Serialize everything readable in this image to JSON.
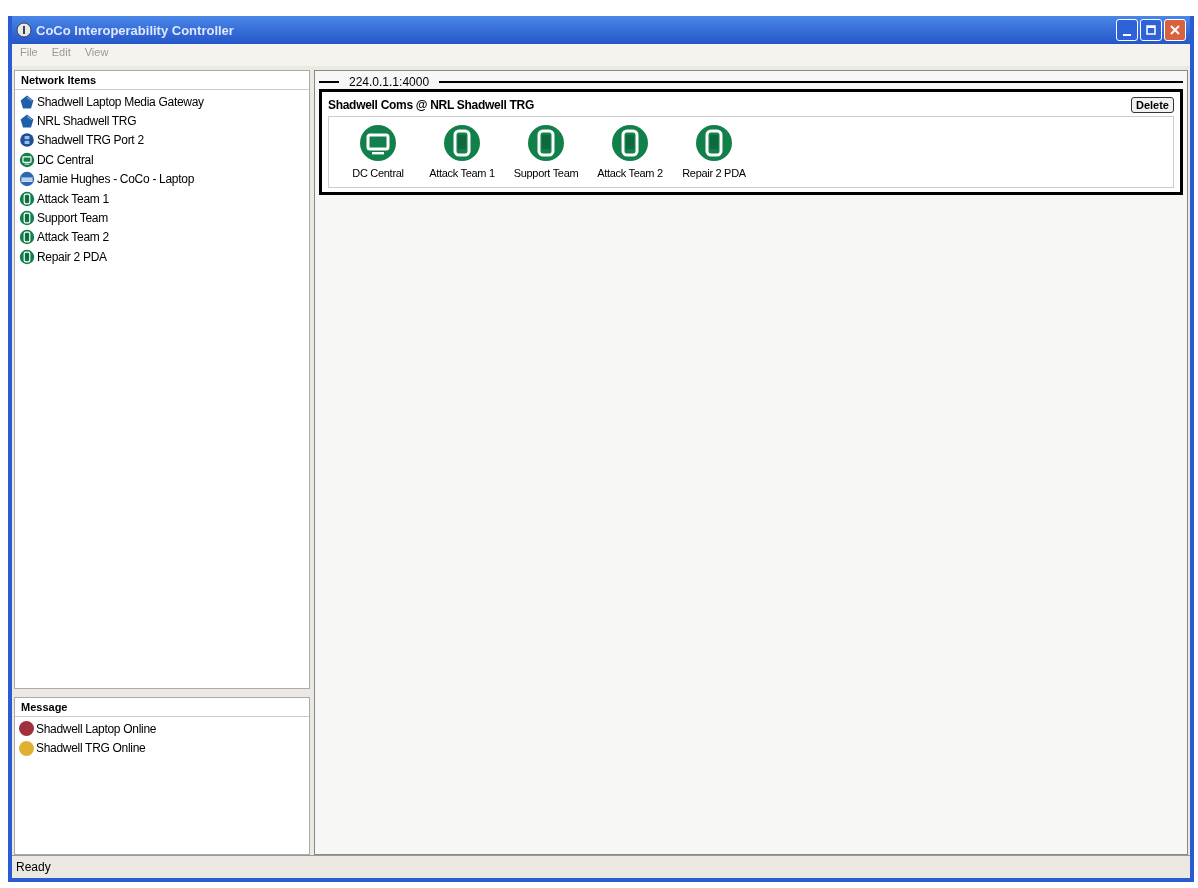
{
  "window": {
    "title": "CoCo Interoperability Controller"
  },
  "menu": [
    "File",
    "Edit",
    "View"
  ],
  "network_panel": {
    "title": "Network Items",
    "items": [
      {
        "label": "Shadwell Laptop Media Gateway",
        "kind": "gateway"
      },
      {
        "label": "NRL Shadwell TRG",
        "kind": "gateway"
      },
      {
        "label": "Shadwell TRG Port 2",
        "kind": "port"
      },
      {
        "label": "DC Central",
        "kind": "workstation"
      },
      {
        "label": "Jamie Hughes - CoCo - Laptop",
        "kind": "laptop"
      },
      {
        "label": "Attack Team 1",
        "kind": "handheld"
      },
      {
        "label": "Support Team",
        "kind": "handheld"
      },
      {
        "label": "Attack Team 2",
        "kind": "handheld"
      },
      {
        "label": "Repair 2 PDA",
        "kind": "handheld"
      }
    ]
  },
  "message_panel": {
    "title": "Message",
    "items": [
      {
        "text": "Shadwell Laptop Online",
        "color": "#a0303c"
      },
      {
        "text": "Shadwell TRG Online",
        "color": "#e0b030"
      }
    ]
  },
  "channel": {
    "address": "224.0.1.1:4000",
    "group": {
      "title": "Shadwell Coms @ NRL Shadwell TRG",
      "delete_button": "Delete",
      "nodes": [
        {
          "label": "DC Central",
          "kind": "workstation"
        },
        {
          "label": "Attack Team 1",
          "kind": "handheld"
        },
        {
          "label": "Support Team",
          "kind": "handheld"
        },
        {
          "label": "Attack Team 2",
          "kind": "handheld"
        },
        {
          "label": "Repair 2 PDA",
          "kind": "handheld"
        }
      ]
    }
  },
  "status_bar": "Ready"
}
